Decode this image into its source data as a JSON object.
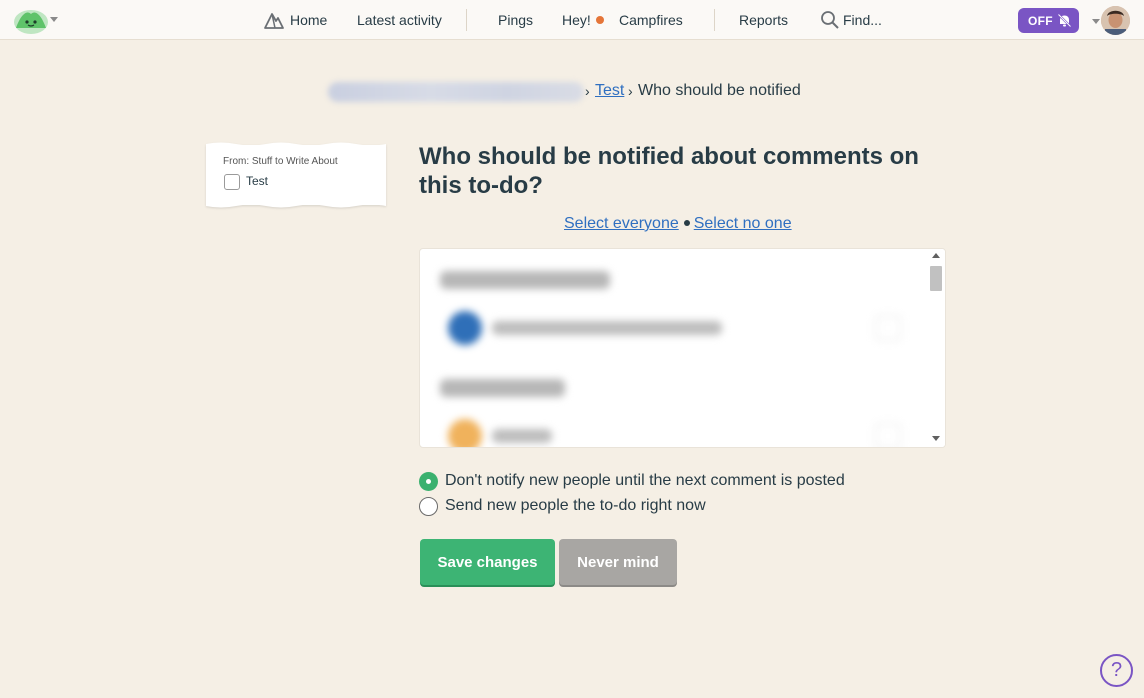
{
  "nav": {
    "home": "Home",
    "latest_activity": "Latest activity",
    "pings": "Pings",
    "hey": "Hey!",
    "campfires": "Campfires",
    "reports": "Reports",
    "find": "Find...",
    "off_toggle": "OFF"
  },
  "breadcrumb": {
    "separator": "›",
    "link": "Test",
    "current": "Who should be notified"
  },
  "todo_card": {
    "from": "From: Stuff to Write About",
    "title": "Test"
  },
  "form": {
    "heading": "Who should be notified about comments on this to-do?",
    "select_everyone": "Select everyone",
    "select_no_one": "Select no one",
    "options": [
      {
        "label": "Don't notify new people until the next comment is posted",
        "selected": true
      },
      {
        "label": "Send new people the to-do right now",
        "selected": false
      }
    ],
    "save_label": "Save changes",
    "cancel_label": "Never mind"
  },
  "help": "?",
  "colors": {
    "background": "#f5efe5",
    "accent_purple": "#7a55c4",
    "save_green": "#3db474",
    "link_blue": "#2f6fc0",
    "notification_dot": "#e57538"
  }
}
